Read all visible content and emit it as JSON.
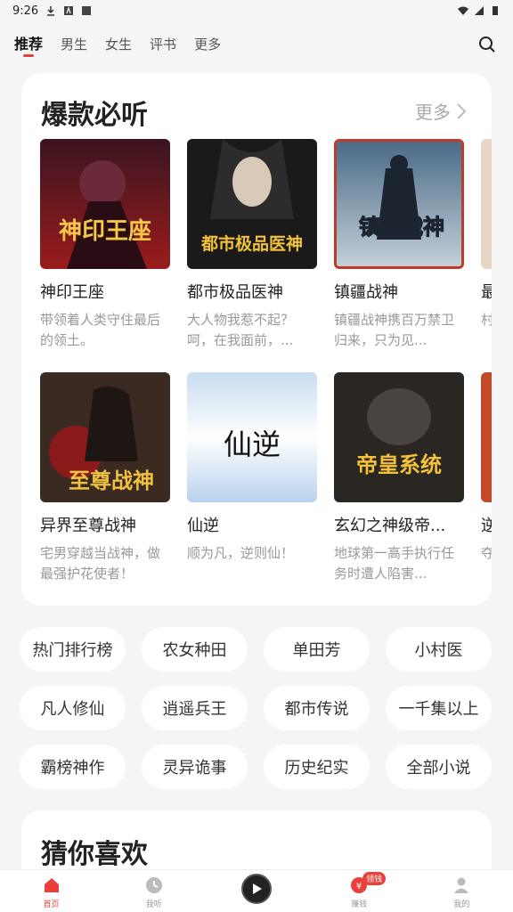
{
  "status_bar": {
    "time": "9:26"
  },
  "top_nav": {
    "tabs": [
      {
        "label": "推荐"
      },
      {
        "label": "男生"
      },
      {
        "label": "女生"
      },
      {
        "label": "评书"
      },
      {
        "label": "更多"
      }
    ],
    "active_tab": "推荐",
    "search_icon": "search-icon"
  },
  "hot_section": {
    "title": "爆款必听",
    "more_label": "更多",
    "books": [
      {
        "title": "神印王座",
        "desc": "带领着人类守住最后的领土。",
        "cover_text": "神印王座"
      },
      {
        "title": "都市极品医神",
        "desc": "大人物我惹不起？呵，在我面前，...",
        "cover_text": "都市极品医神"
      },
      {
        "title": "镇疆战神",
        "desc": "镇疆战神携百万禁卫归来，只为见...",
        "cover_text": "镇疆战神"
      },
      {
        "title": "最",
        "desc": "村豪",
        "cover_text": ""
      },
      {
        "title": "异界至尊战神",
        "desc": "宅男穿越当战神，做最强护花使者！",
        "cover_text": "至尊战神"
      },
      {
        "title": "仙逆",
        "desc": "顺为凡，逆则仙！",
        "cover_text": "仙逆"
      },
      {
        "title": "玄幻之神级帝...",
        "desc": "地球第一高手执行任务时遭人陷害...",
        "cover_text": "帝皇系统"
      },
      {
        "title": "逆",
        "desc": "夺乱",
        "cover_text": ""
      }
    ]
  },
  "chips": [
    "热门排行榜",
    "农女种田",
    "单田芳",
    "小村医",
    "凡人修仙",
    "逍遥兵王",
    "都市传说",
    "一千集以上",
    "霸榜神作",
    "灵异诡事",
    "历史纪实",
    "全部小说"
  ],
  "guess_section": {
    "title": "猜你喜欢"
  },
  "bottom_bar": {
    "items": [
      {
        "label": "首页",
        "icon": "home-icon"
      },
      {
        "label": "我听",
        "icon": "clock-icon"
      },
      {
        "label": "",
        "icon": "play-icon"
      },
      {
        "label": "赚钱",
        "icon": "coin-icon",
        "badge": "领钱"
      },
      {
        "label": "我的",
        "icon": "user-icon"
      }
    ]
  },
  "colors": {
    "accent": "#e8413b",
    "background": "#f5f5f5"
  }
}
